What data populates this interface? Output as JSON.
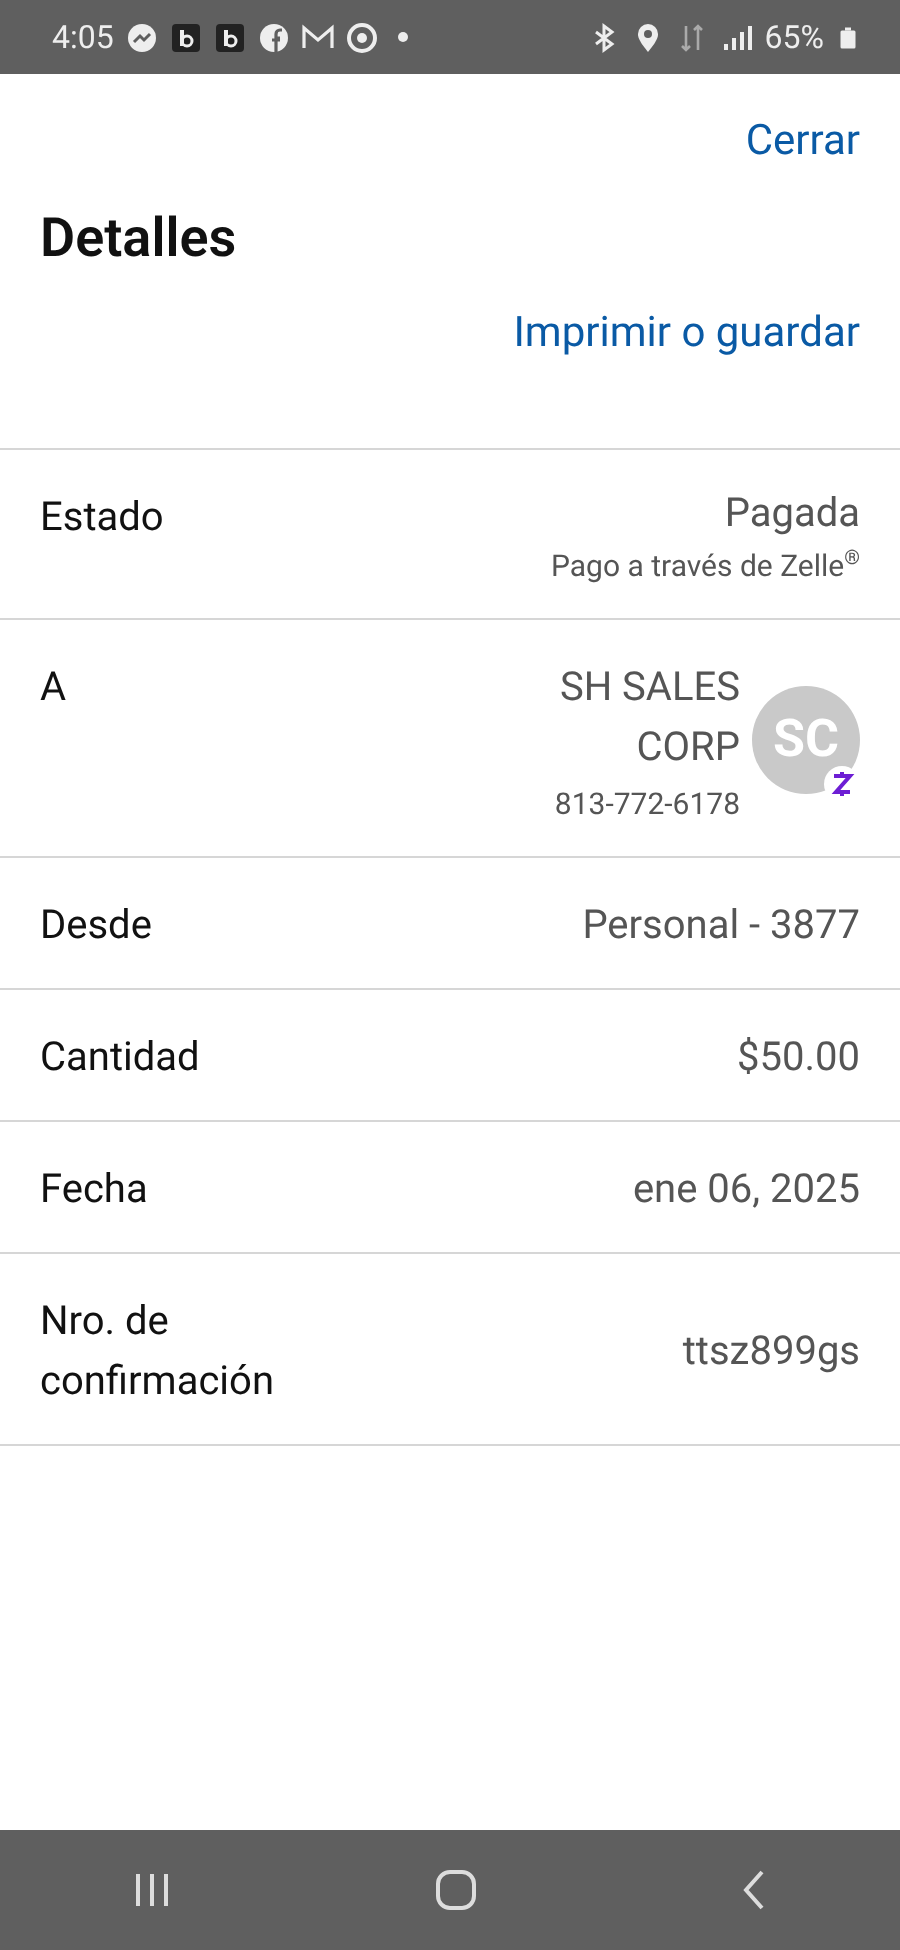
{
  "status_bar": {
    "time": "4:05",
    "battery": "65%"
  },
  "header": {
    "close": "Cerrar",
    "title": "Detalles",
    "print": "Imprimir o guardar"
  },
  "rows": [
    {
      "kind": "text",
      "label": "Estado",
      "value": "Pagada",
      "subtext": "Pago a través de Zelle$^{®}$"
    },
    {
      "kind": "contact",
      "label": "A",
      "value": "SH SALES CORP",
      "subtext": "813-772-6178",
      "initials": "SC"
    },
    {
      "kind": "text",
      "label": "Desde",
      "value": "Personal - 3877"
    },
    {
      "kind": "text",
      "label": "Cantidad",
      "value": "$50.00"
    },
    {
      "kind": "text",
      "label": "Fecha",
      "value": "ene 06, 2025"
    },
    {
      "kind": "text",
      "label": "Nro. de confirmación",
      "value": "ttsz899gs"
    }
  ]
}
